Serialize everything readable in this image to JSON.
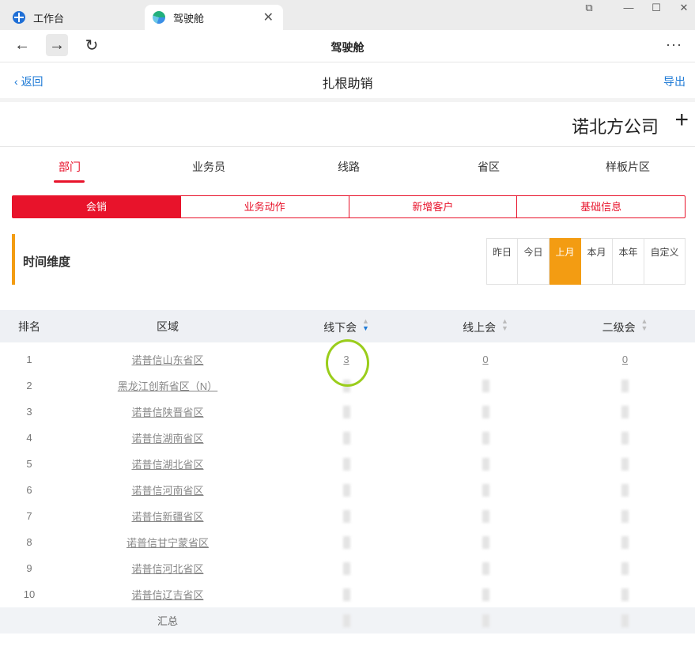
{
  "window": {
    "tabs": [
      {
        "label": "工作台"
      },
      {
        "label": "驾驶舱"
      }
    ],
    "title": "驾驶舱"
  },
  "header": {
    "back": "返回",
    "title": "扎根助销",
    "export": "导出"
  },
  "company": "诺北方公司",
  "category_tabs": [
    "部门",
    "业务员",
    "线路",
    "省区",
    "样板片区"
  ],
  "segments": [
    "会销",
    "业务动作",
    "新增客户",
    "基础信息"
  ],
  "time": {
    "label": "时间维度",
    "options": [
      "昨日",
      "今日",
      "上月",
      "本月",
      "本年",
      "自定义"
    ],
    "selected": "上月"
  },
  "table": {
    "headers": [
      "排名",
      "区域",
      "线下会",
      "线上会",
      "二级会"
    ],
    "rows": [
      {
        "rank": "1",
        "region": "诺普信山东省区",
        "offline": "3",
        "online": "0",
        "secondary": "0"
      },
      {
        "rank": "2",
        "region": "黑龙江创新省区（N）",
        "offline": "",
        "online": "",
        "secondary": ""
      },
      {
        "rank": "3",
        "region": "诺普信陕晋省区",
        "offline": "",
        "online": "",
        "secondary": ""
      },
      {
        "rank": "4",
        "region": "诺普信湖南省区",
        "offline": "",
        "online": "",
        "secondary": ""
      },
      {
        "rank": "5",
        "region": "诺普信湖北省区",
        "offline": "",
        "online": "",
        "secondary": ""
      },
      {
        "rank": "6",
        "region": "诺普信河南省区",
        "offline": "",
        "online": "",
        "secondary": ""
      },
      {
        "rank": "7",
        "region": "诺普信新疆省区",
        "offline": "",
        "online": "",
        "secondary": ""
      },
      {
        "rank": "8",
        "region": "诺普信甘宁蒙省区",
        "offline": "",
        "online": "",
        "secondary": ""
      },
      {
        "rank": "9",
        "region": "诺普信河北省区",
        "offline": "",
        "online": "",
        "secondary": ""
      },
      {
        "rank": "10",
        "region": "诺普信辽吉省区",
        "offline": "",
        "online": "",
        "secondary": ""
      }
    ],
    "total_label": "汇总"
  },
  "colors": {
    "accent_red": "#e8132b",
    "accent_orange": "#f39c12",
    "link_blue": "#1e7ad6",
    "highlight_green": "#9acd1b"
  }
}
